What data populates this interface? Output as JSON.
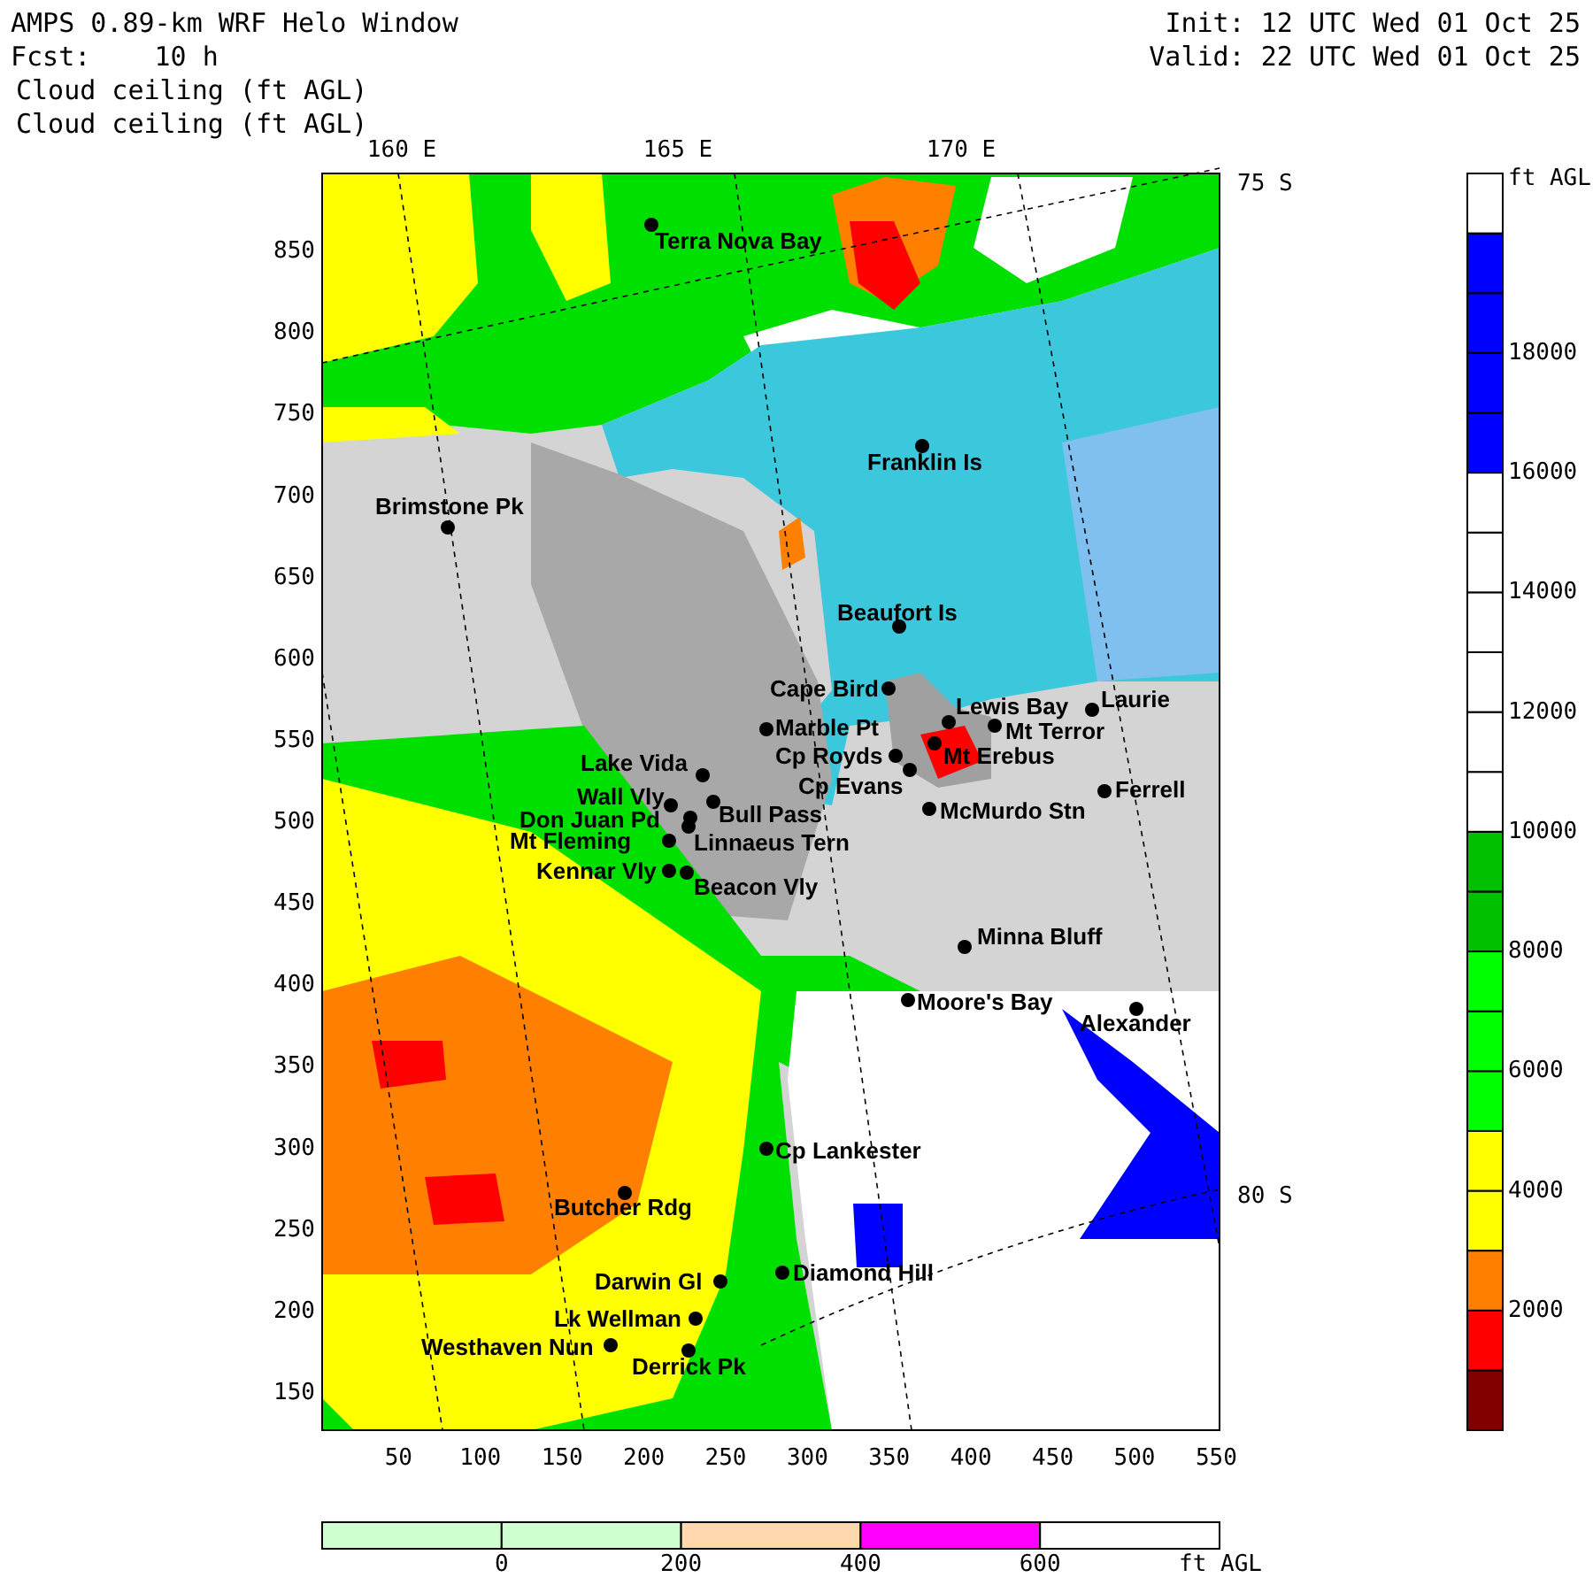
{
  "header": {
    "title": "AMPS 0.89-km WRF Helo Window",
    "forecast": "Fcst:    10 h",
    "init": "Init: 12 UTC Wed 01 Oct 25",
    "valid": "Valid: 22 UTC Wed 01 Oct 25",
    "field_lines": [
      "Cloud ceiling (ft AGL)",
      "Cloud ceiling (ft AGL)"
    ]
  },
  "map": {
    "lon_labels": [
      "160 E",
      "165 E",
      "170 E"
    ],
    "lat_labels": [
      "75 S",
      "80 S"
    ],
    "x_ticks": [
      "50",
      "100",
      "150",
      "200",
      "250",
      "300",
      "350",
      "400",
      "450",
      "500",
      "550"
    ],
    "y_ticks": [
      "850",
      "800",
      "750",
      "700",
      "650",
      "600",
      "550",
      "500",
      "450",
      "400",
      "350",
      "300",
      "250",
      "200",
      "150"
    ],
    "stations": [
      {
        "name": "Terra Nova Bay"
      },
      {
        "name": "Franklin Is"
      },
      {
        "name": "Brimstone Pk"
      },
      {
        "name": "Beaufort Is"
      },
      {
        "name": "Cape Bird"
      },
      {
        "name": "Lewis Bay"
      },
      {
        "name": "Laurie"
      },
      {
        "name": "Marble Pt"
      },
      {
        "name": "Mt Terror"
      },
      {
        "name": "Cp Royds"
      },
      {
        "name": "Mt Erebus"
      },
      {
        "name": "Lake Vida"
      },
      {
        "name": "Cp Evans"
      },
      {
        "name": "Ferrell"
      },
      {
        "name": "Wall Vly"
      },
      {
        "name": "Bull Pass"
      },
      {
        "name": "McMurdo Stn"
      },
      {
        "name": "Don Juan Pd"
      },
      {
        "name": "Mt Fleming"
      },
      {
        "name": "Linnaeus Tern"
      },
      {
        "name": "Kennar Vly"
      },
      {
        "name": "Beacon Vly"
      },
      {
        "name": "Minna Bluff"
      },
      {
        "name": "Moore's Bay"
      },
      {
        "name": "Alexander"
      },
      {
        "name": "Cp Lankester"
      },
      {
        "name": "Butcher Rdg"
      },
      {
        "name": "Diamond Hill"
      },
      {
        "name": "Darwin Gl"
      },
      {
        "name": "Lk Wellman"
      },
      {
        "name": "Westhaven Nun"
      },
      {
        "name": "Derrick Pk"
      }
    ]
  },
  "colorbar": {
    "unit": "ft AGL",
    "labels": [
      "18000",
      "16000",
      "14000",
      "12000",
      "10000",
      "8000",
      "6000",
      "4000",
      "2000"
    ],
    "segments": [
      {
        "color": "#800000"
      },
      {
        "color": "#ff0000"
      },
      {
        "color": "#ff8000"
      },
      {
        "color": "#ffff00"
      },
      {
        "color": "#ffff00"
      },
      {
        "color": "#00ff00"
      },
      {
        "color": "#00ff00"
      },
      {
        "color": "#00ff00"
      },
      {
        "color": "#00c000"
      },
      {
        "color": "#00c000"
      },
      {
        "color": "#ffffff"
      },
      {
        "color": "#ffffff"
      },
      {
        "color": "#ffffff"
      },
      {
        "color": "#ffffff"
      },
      {
        "color": "#ffffff"
      },
      {
        "color": "#ffffff"
      },
      {
        "color": "#0000ff"
      },
      {
        "color": "#0000ff"
      },
      {
        "color": "#0000ff"
      },
      {
        "color": "#0000ff"
      },
      {
        "color": "#ffffff"
      }
    ]
  },
  "low_bar": {
    "unit": "ft AGL",
    "labels": [
      "0",
      "200",
      "400",
      "600"
    ],
    "segments": [
      {
        "color": "#d0ffd0"
      },
      {
        "color": "#d0ffd0"
      },
      {
        "color": "#ffd8b0"
      },
      {
        "color": "#ff00ff"
      },
      {
        "color": "#ffffff"
      }
    ]
  }
}
